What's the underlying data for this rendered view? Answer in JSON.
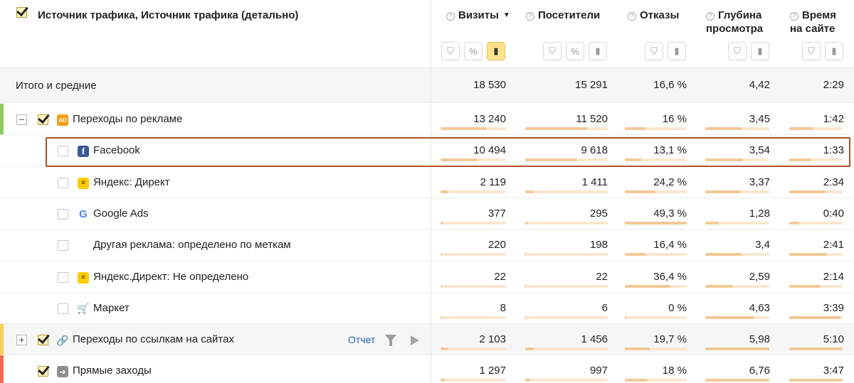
{
  "header": {
    "title": "Источник трафика, Источник трафика (детально)",
    "columns": [
      {
        "label_line1": "Визиты",
        "label_line2": "",
        "has_help": true,
        "sorted": true
      },
      {
        "label_line1": "Посетители",
        "label_line2": "",
        "has_help": true
      },
      {
        "label_line1": "Отказы",
        "label_line2": "",
        "has_help": true
      },
      {
        "label_line1": "Глубина",
        "label_line2": "просмотра",
        "has_help": true
      },
      {
        "label_line1": "Время",
        "label_line2": "на сайте",
        "has_help": true
      }
    ],
    "help_glyph": "?",
    "sort_glyph": "▼",
    "filter_glyph": "⛉",
    "percent_glyph": "%",
    "chart_glyph": "▮"
  },
  "totals": {
    "label": "Итого и средние",
    "values": [
      "18 530",
      "15 291",
      "16,6 %",
      "4,42",
      "2:29"
    ]
  },
  "rows": [
    {
      "label": "Переходы по рекламе",
      "level": 0,
      "checked": true,
      "toggle": "−",
      "icon": "ad-icon",
      "icon_text": "AD",
      "accent": "#8ccc5a",
      "values": [
        "13 240",
        "11 520",
        "16 %",
        "3,45",
        "1:42"
      ],
      "fractions": [
        0.71,
        0.75,
        0.33,
        0.58,
        0.45
      ]
    },
    {
      "label": "Facebook",
      "level": 1,
      "checked": false,
      "icon": "facebook-icon",
      "icon_text": "f",
      "values": [
        "10 494",
        "9 618",
        "13,1 %",
        "3,54",
        "1:33"
      ],
      "fractions": [
        0.57,
        0.63,
        0.27,
        0.59,
        0.41
      ]
    },
    {
      "label": "Яндекс: Директ",
      "level": 1,
      "checked": false,
      "icon": "yandex-direct-icon",
      "icon_text": "≡",
      "values": [
        "2 119",
        "1 411",
        "24,2 %",
        "3,37",
        "2:34"
      ],
      "fractions": [
        0.12,
        0.1,
        0.49,
        0.56,
        0.68
      ]
    },
    {
      "label": "Google Ads",
      "level": 1,
      "checked": false,
      "icon": "google-icon",
      "icon_text": "G",
      "values": [
        "377",
        "295",
        "49,3 %",
        "1,28",
        "0:40"
      ],
      "fractions": [
        0.03,
        0.03,
        1.0,
        0.21,
        0.18
      ]
    },
    {
      "label": "Другая реклама: определено по меткам",
      "level": 1,
      "checked": false,
      "icon": "",
      "icon_text": "",
      "values": [
        "220",
        "198",
        "16,4 %",
        "3,4",
        "2:41"
      ],
      "fractions": [
        0.02,
        0.02,
        0.33,
        0.57,
        0.71
      ]
    },
    {
      "label": "Яндекс.Директ: Не определено",
      "level": 1,
      "checked": false,
      "icon": "yandex-direct-icon",
      "icon_text": "≡",
      "values": [
        "22",
        "22",
        "36,4 %",
        "2,59",
        "2:14"
      ],
      "fractions": [
        0.01,
        0.01,
        0.74,
        0.43,
        0.59
      ]
    },
    {
      "label": "Маркет",
      "level": 1,
      "checked": false,
      "icon": "market-cart-icon",
      "icon_text": "🛒",
      "values": [
        "8",
        "6",
        "0 %",
        "4,63",
        "3:39"
      ],
      "fractions": [
        0.01,
        0.01,
        0.0,
        0.77,
        0.96
      ]
    },
    {
      "label": "Переходы по ссылкам на сайтах",
      "level": 0,
      "checked": true,
      "toggle": "+",
      "icon": "link-icon",
      "icon_text": "🔗",
      "accent": "#f7d154",
      "grey": true,
      "values": [
        "2 103",
        "1 456",
        "19,7 %",
        "5,98",
        "5:10"
      ],
      "fractions": [
        0.12,
        0.1,
        0.4,
        1.0,
        1.0
      ],
      "report_label": "Отчет"
    },
    {
      "label": "Прямые заходы",
      "level": 0,
      "checked": true,
      "icon": "direct-entry-icon",
      "icon_text": "➜",
      "accent": "#f26b4c",
      "values": [
        "1 297",
        "997",
        "18 %",
        "6,76",
        "3:47"
      ],
      "fractions": [
        0.07,
        0.06,
        0.37,
        1.0,
        1.0
      ]
    }
  ],
  "highlighted_row": "Facebook"
}
